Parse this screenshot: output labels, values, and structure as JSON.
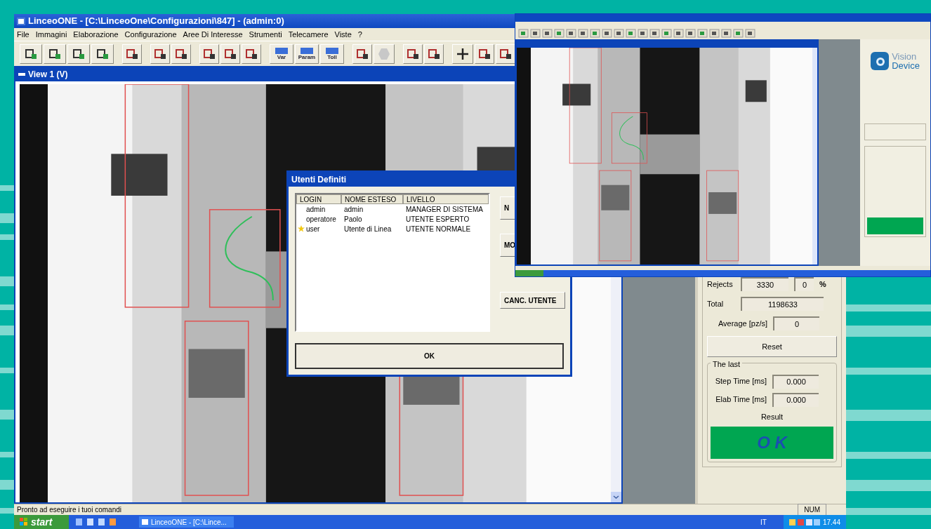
{
  "main_window": {
    "title": "LinceoONE - [C:\\LinceoOne\\Configurazioni\\847] - (admin:0)",
    "menu": [
      "File",
      "Immagini",
      "Elaborazione",
      "Configurazione",
      "Aree Di Interesse",
      "Strumenti",
      "Telecamere",
      "Viste",
      "?"
    ],
    "toolbar": [
      {
        "kind": "icon"
      },
      {
        "kind": "icon"
      },
      {
        "kind": "icon"
      },
      {
        "kind": "icon"
      },
      {
        "kind": "gap"
      },
      {
        "kind": "icon"
      },
      {
        "kind": "gap"
      },
      {
        "kind": "icon"
      },
      {
        "kind": "icon"
      },
      {
        "kind": "gap"
      },
      {
        "kind": "icon"
      },
      {
        "kind": "icon"
      },
      {
        "kind": "icon"
      },
      {
        "kind": "gap"
      },
      {
        "kind": "labeled",
        "label": "Var"
      },
      {
        "kind": "labeled",
        "label": "Param"
      },
      {
        "kind": "labeled",
        "label": "Toll"
      },
      {
        "kind": "gap"
      },
      {
        "kind": "icon"
      },
      {
        "kind": "disabled"
      },
      {
        "kind": "gap"
      },
      {
        "kind": "icon"
      },
      {
        "kind": "icon"
      },
      {
        "kind": "gap"
      },
      {
        "kind": "plus"
      },
      {
        "kind": "icon"
      },
      {
        "kind": "icon"
      }
    ],
    "view": {
      "title": "View 1 (V)"
    },
    "panel": {
      "rows": [
        {
          "kind": "pair",
          "label": "Rejects",
          "value": "3330",
          "percent": "0",
          "unit": "%"
        },
        {
          "kind": "single",
          "label": "Total",
          "value": "1198633"
        },
        {
          "kind": "short",
          "label": "Average [pz/s]",
          "value": "0"
        }
      ],
      "reset": "Reset",
      "last": {
        "title": "The last",
        "rows": [
          {
            "label": "Step Time [ms]",
            "value": "0.000"
          },
          {
            "label": "Elab Time [ms]",
            "value": "0.000"
          }
        ]
      },
      "result_label": "Result",
      "result": "O K"
    },
    "status_bar": {
      "message": "Pronto ad eseguire i tuoi comandi",
      "indicator": "NUM"
    }
  },
  "dialog": {
    "title": "Utenti Definiti",
    "columns": [
      "LOGIN",
      "NOME ESTESO",
      "LIVELLO"
    ],
    "rows": [
      {
        "login": "admin",
        "name": "admin",
        "level": "MANAGER DI SISTEMA",
        "current": false
      },
      {
        "login": "operatore",
        "name": "Paolo",
        "level": "UTENTE ESPERTO",
        "current": false
      },
      {
        "login": "user",
        "name": "Utente di Linea",
        "level": "UTENTE NORMALE",
        "current": true
      }
    ],
    "side_buttons": [
      "N",
      "MO",
      "CANC. UTENTE"
    ],
    "ok": "OK"
  },
  "inset_window": {
    "logo": [
      "Vision",
      "Device"
    ]
  },
  "taskbar": {
    "start": "start",
    "tasks": [
      {
        "label": "LinceoONE - [C:\\Lince...",
        "selected": false
      }
    ],
    "language": "IT",
    "clock": "17.44"
  }
}
